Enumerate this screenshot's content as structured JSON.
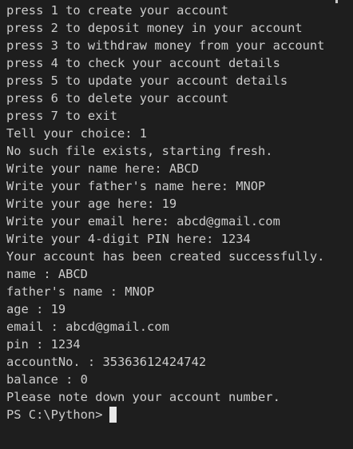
{
  "terminal": {
    "lines": [
      "press 1 to create your account",
      "press 2 to deposit money in your account",
      "press 3 to withdraw money from your account",
      "press 4 to check your account details",
      "press 5 to update your account details",
      "press 6 to delete your account",
      "press 7 to exit",
      "Tell your choice: 1",
      "No such file exists, starting fresh.",
      "Write your name here: ABCD",
      "Write your father's name here: MNOP",
      "Write your age here: 19",
      "Write your email here: abcd@gmail.com",
      "Write your 4-digit PIN here: 1234",
      "Your account has been created successfully.",
      "name : ABCD",
      "father's name : MNOP",
      "age : 19",
      "email : abcd@gmail.com",
      "pin : 1234",
      "accountNo. : 35363612424742",
      "balance : 0",
      "Please note down your account number."
    ],
    "prompt": "PS C:\\Python>"
  }
}
